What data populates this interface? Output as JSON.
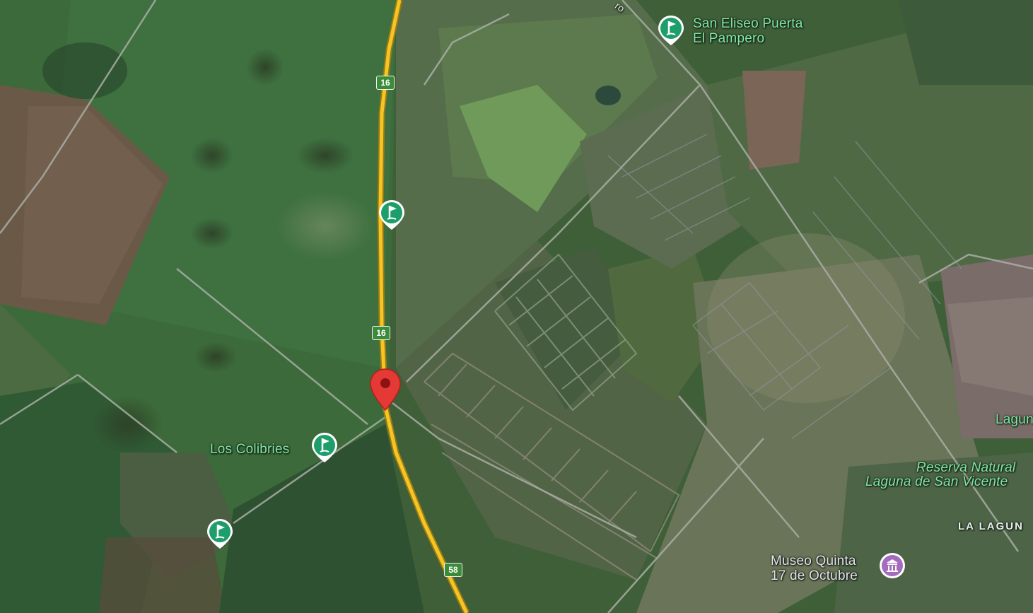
{
  "places": {
    "san_eliseo": [
      "San Eliseo Puerta",
      "El Pampero"
    ],
    "los_colibries": "Los Colibries",
    "laguna_cut": "Lagun",
    "reserva": [
      "Reserva Natural",
      "Laguna de San Vicente"
    ],
    "la_laguna": "LA LAGUN",
    "museo": [
      "Museo Quinta",
      "17 de Octubre"
    ]
  },
  "roads": {
    "route_16_a": "16",
    "route_16_b": "16",
    "route_58": "58",
    "street_fragment": "ro"
  },
  "colors": {
    "poi_green": "#1e9e6a",
    "museum_purple": "#a56bbe",
    "pin_red": "#e53935",
    "highway_yellow": "#f3c623",
    "label_green": "#7fe7a8"
  },
  "icons": {
    "golf": "golf-course-icon",
    "museum": "museum-icon",
    "pin": "map-pin-icon"
  }
}
